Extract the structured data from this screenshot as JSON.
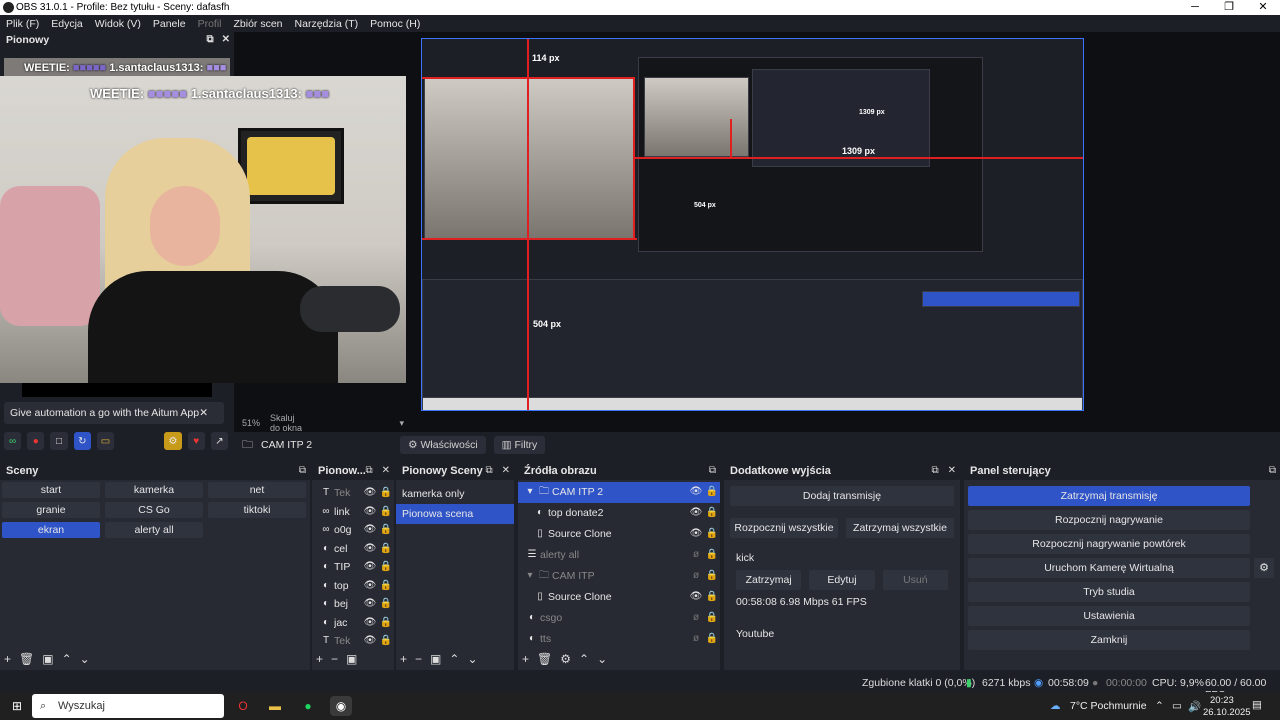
{
  "window": {
    "title": "OBS 31.0.1 - Profile: Bez tytułu - Sceny: dafasfh",
    "minimize": "─",
    "maximize": "❐",
    "close": "✕"
  },
  "menu": [
    "Plik (F)",
    "Edycja",
    "Widok (V)",
    "Panele",
    "Profil",
    "Zbiór scen",
    "Narzędzia (T)",
    "Pomoc (H)"
  ],
  "left_dock": {
    "title": "Pionowy",
    "overlay_line1_a": "WEETIE:",
    "overlay_line1_b": "1.santaclaus1313:",
    "overlay_line2_a": "WEETIE:",
    "overlay_line2_b": "1.santaclaus1313:",
    "annotation": "Give automation a go with the Aitum App",
    "annotation_close": "✕"
  },
  "preview": {
    "zoom": "51%",
    "scale_mode": "Skaluj do okna",
    "label_top": "114 px",
    "label_right": "1309 px",
    "label_mid": "504 px",
    "label_small_mid": "504 px",
    "label_small_right": "1309 px"
  },
  "source_bar": {
    "name": "CAM ITP 2",
    "properties": "Właściwości",
    "filters": "Filtry"
  },
  "scenes": {
    "title": "Sceny",
    "items": [
      "start",
      "kamerka",
      "net",
      "granie",
      "CS Go",
      "tiktoki",
      "ekran",
      "alerty all"
    ],
    "selected_index": 6
  },
  "vertical_sources": {
    "title": "Pionow...",
    "items": [
      "Tek",
      "link",
      "o0g",
      "cel",
      "TIP",
      "top",
      "bej",
      "jac",
      "Tek"
    ]
  },
  "vertical_scenes": {
    "title": "Pionowy Sceny",
    "items": [
      "kamerka only",
      "Pionowa scena"
    ],
    "selected_index": 1
  },
  "sources": {
    "title": "Źródła obrazu",
    "items": [
      {
        "name": "CAM ITP 2",
        "visible": true,
        "selected": true,
        "level": 0,
        "group": true
      },
      {
        "name": "top donate2",
        "visible": true,
        "level": 1
      },
      {
        "name": "Source Clone",
        "visible": true,
        "level": 1
      },
      {
        "name": "alerty all",
        "visible": false,
        "level": 0
      },
      {
        "name": "CAM ITP",
        "visible": false,
        "level": 0,
        "group": true
      },
      {
        "name": "Source Clone",
        "visible": true,
        "level": 1
      },
      {
        "name": "csgo",
        "visible": false,
        "level": 0
      },
      {
        "name": "tts",
        "visible": false,
        "level": 0
      }
    ]
  },
  "extra_outputs": {
    "title": "Dodatkowe wyjścia",
    "add": "Dodaj transmisję",
    "start_all": "Rozpocznij wszystkie",
    "stop_all": "Zatrzymaj wszystkie",
    "output_name": "kick",
    "stop": "Zatrzymaj",
    "edit": "Edytuj",
    "remove": "Usuń",
    "stats": "00:58:08  6.98 Mbps  61 FPS",
    "output2": "Youtube"
  },
  "controls": {
    "title": "Panel sterujący",
    "buttons": [
      "Zatrzymaj transmisję",
      "Rozpocznij nagrywanie",
      "Rozpocznij nagrywanie powtórek",
      "Uruchom Kamerę Wirtualną",
      "Tryb studia",
      "Ustawienia",
      "Zamknij"
    ]
  },
  "status": {
    "dropped": "Zgubione klatki 0 (0,0%)",
    "bitrate": "6271 kbps",
    "stream_time": "00:58:09",
    "rec_time": "00:00:00",
    "cpu": "CPU: 9,9%",
    "fps": "60.00 / 60.00 FPS"
  },
  "taskbar": {
    "search": "Wyszukaj",
    "weather": "7°C  Pochmurnie",
    "time": "20:23",
    "date": "26.10.2025"
  },
  "colors": {
    "accent": "#2f54c8",
    "preview_border": "#3b74ff",
    "guide": "#e02020"
  }
}
